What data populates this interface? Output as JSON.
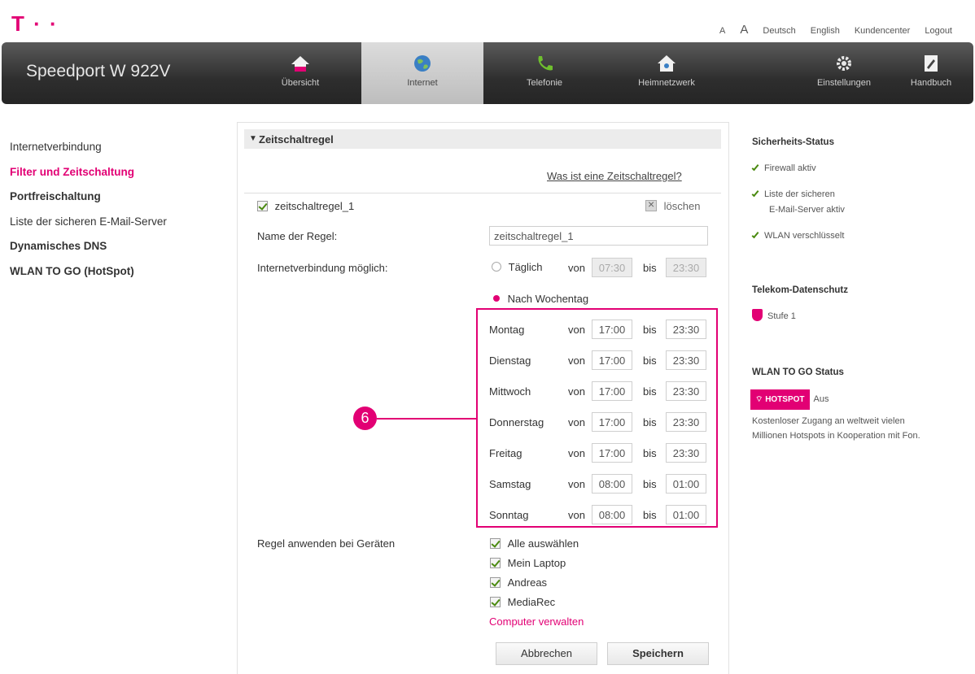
{
  "brand": {
    "logo_text": "T · ·",
    "product": "Speedport W 922V"
  },
  "toplinks": {
    "font_small": "A",
    "font_large": "A",
    "deutsch": "Deutsch",
    "english": "English",
    "kundencenter": "Kundencenter",
    "logout": "Logout"
  },
  "nav": [
    {
      "label": "Übersicht",
      "icon": "home-icon"
    },
    {
      "label": "Internet",
      "icon": "globe-icon",
      "active": true
    },
    {
      "label": "Telefonie",
      "icon": "phone-icon"
    },
    {
      "label": "Heimnetzwerk",
      "icon": "home-network-icon"
    },
    {
      "label": "Einstellungen",
      "icon": "gear-icon"
    },
    {
      "label": "Handbuch",
      "icon": "manual-icon"
    }
  ],
  "sidebar": {
    "items": [
      {
        "label": "Internetverbindung"
      },
      {
        "label": "Filter und Zeitschaltung",
        "selected": true
      },
      {
        "label": "Portfreischaltung"
      },
      {
        "label": "Liste der sicheren E-Mail-Server"
      },
      {
        "label": "Dynamisches DNS"
      },
      {
        "label": "WLAN TO GO (HotSpot)"
      }
    ]
  },
  "panel": {
    "title": "Zeitschaltregel",
    "help_link": "Was ist eine Zeitschaltregel?",
    "rule_checkbox_label": "zeitschaltregel_1",
    "delete_label": "löschen",
    "name_label": "Name der Regel:",
    "name_value": "zeitschaltregel_1",
    "internet_label": "Internetverbindung möglich:",
    "daily_label": "Täglich",
    "von": "von",
    "bis": "bis",
    "daily_from": "07:30",
    "daily_to": "23:30",
    "weekday_label": "Nach Wochentag",
    "days": [
      {
        "day": "Montag",
        "from": "17:00",
        "to": "23:30"
      },
      {
        "day": "Dienstag",
        "from": "17:00",
        "to": "23:30"
      },
      {
        "day": "Mittwoch",
        "from": "17:00",
        "to": "23:30"
      },
      {
        "day": "Donnerstag",
        "from": "17:00",
        "to": "23:30"
      },
      {
        "day": "Freitag",
        "from": "17:00",
        "to": "23:30"
      },
      {
        "day": "Samstag",
        "from": "08:00",
        "to": "01:00"
      },
      {
        "day": "Sonntag",
        "from": "08:00",
        "to": "01:00"
      }
    ],
    "callout_number": "6",
    "devices_label": "Regel anwenden bei Geräten",
    "devices": [
      {
        "label": "Alle auswählen"
      },
      {
        "label": "Mein Laptop"
      },
      {
        "label": "Andreas"
      },
      {
        "label": "MediaRec"
      }
    ],
    "manage_link": "Computer verwalten",
    "cancel_label": "Abbrechen",
    "save_label": "Speichern"
  },
  "right": {
    "security_title": "Sicherheits-Status",
    "security_items": [
      "Firewall aktiv",
      "Liste der sicheren",
      "E-Mail-Server aktiv",
      "WLAN verschlüsselt"
    ],
    "privacy_title": "Telekom-Datenschutz",
    "privacy_level": "Stufe 1",
    "wlan_title": "WLAN TO GO Status",
    "hotspot_badge": "HOTSPOT",
    "hotspot_status": "Aus",
    "hotspot_desc_1": "Kostenloser Zugang an weltweit vielen",
    "hotspot_desc_2": "Millionen Hotspots in Kooperation mit Fon."
  },
  "colors": {
    "accent": "#e20074",
    "navbar": "#2e2e2e",
    "check": "#4b8a10"
  }
}
